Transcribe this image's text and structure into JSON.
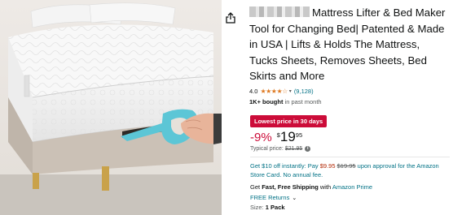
{
  "product": {
    "title": "Mattress Lifter & Bed Maker Tool for Changing Bed| Patented & Made in USA | Lifts & Holds The Mattress, Tucks Sheets, Removes Sheets, Bed Skirts and More",
    "rating_value": "4.0",
    "stars_display": "★★★★☆",
    "rating_count": "(9,128)",
    "bought_strong": "1K+ bought",
    "bought_rest": " in past month",
    "image_icon": "mattress-lifter-product-photo"
  },
  "share": {
    "icon": "share-icon"
  },
  "deal": {
    "badge": "Lowest price in 30 days",
    "color": "#cc0c39"
  },
  "price": {
    "discount": "-9%",
    "symbol": "$",
    "whole": "19",
    "fraction": "95",
    "typical_label": "Typical price:",
    "typical_value": "$21.95"
  },
  "offer": {
    "prefix": "Get $10 off instantly: Pay ",
    "new_price": "$9.95",
    "old_price": "$19.95",
    "suffix": " upon approval for the Amazon Store Card. No annual fee."
  },
  "shipping": {
    "prefix": "Get ",
    "strong": "Fast, Free Shipping",
    "middle": " with ",
    "link": "Amazon Prime",
    "returns": "FREE Returns",
    "size_label": "Size: ",
    "size_value": "1 Pack"
  },
  "colors": {
    "link": "#007185",
    "star": "#de7921",
    "deal": "#cc0c39",
    "accent_tool": "#5cc6d6"
  }
}
